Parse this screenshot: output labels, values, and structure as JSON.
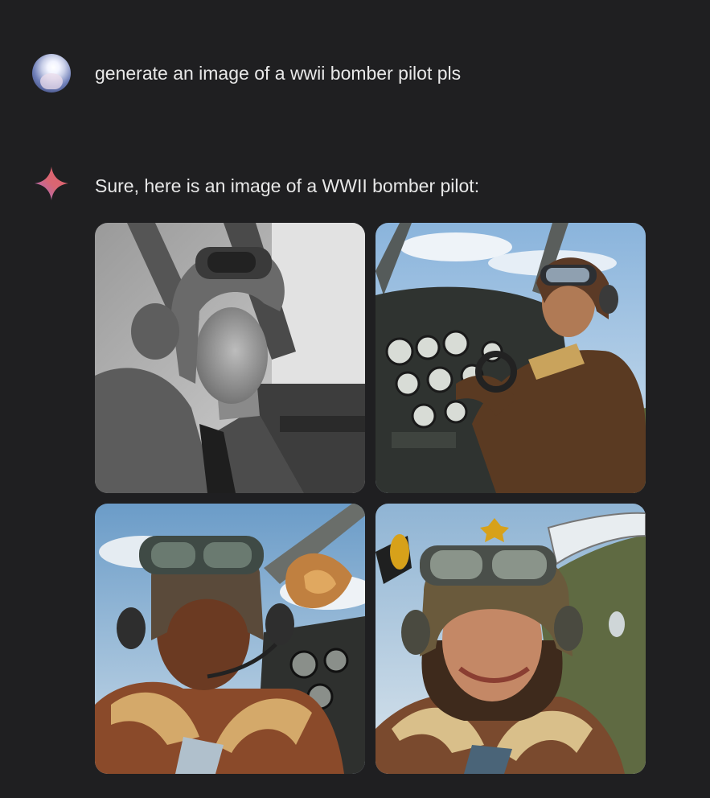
{
  "user_message": {
    "text": "generate an image of a wwii bomber pilot pls"
  },
  "assistant_message": {
    "icon": "gemini-sparkle-icon",
    "text": "Sure, here is an image of a WWII bomber pilot:",
    "images": [
      {
        "name": "generated-image-1",
        "style": "black-and-white photograph"
      },
      {
        "name": "generated-image-2",
        "style": "painting, cockpit interior"
      },
      {
        "name": "generated-image-3",
        "style": "painting"
      },
      {
        "name": "generated-image-4",
        "style": "painting"
      }
    ]
  },
  "colors": {
    "background": "#1f1f21",
    "text": "#e8e8e8",
    "sparkle_start": "#4b7bd8",
    "sparkle_end": "#e0606a"
  }
}
